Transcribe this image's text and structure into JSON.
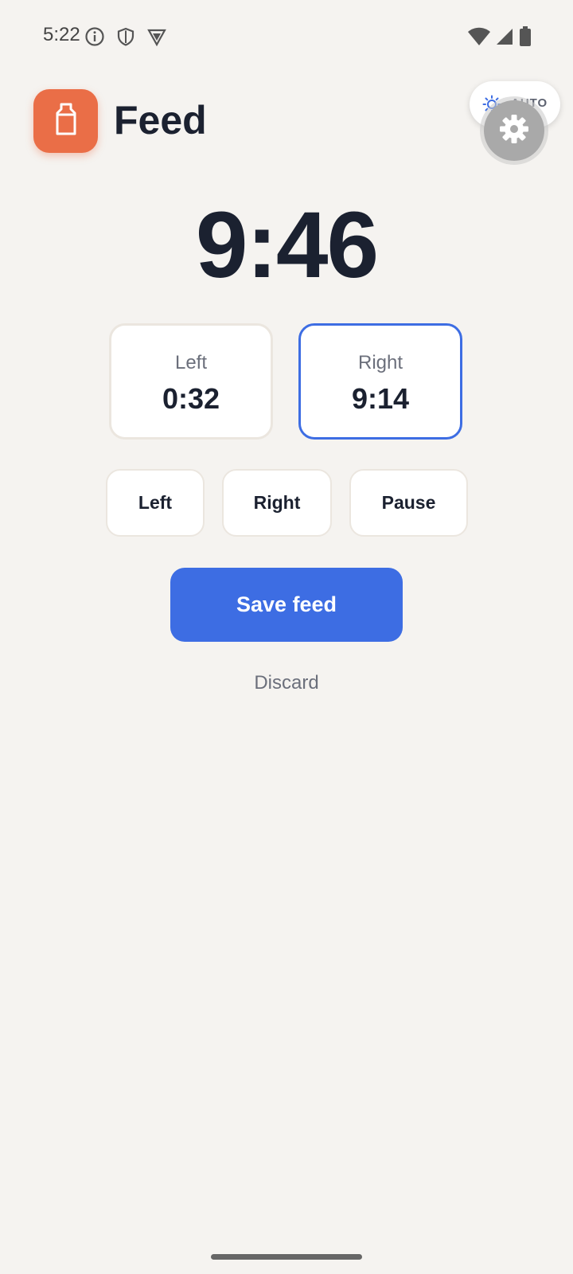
{
  "status_bar": {
    "time": "5:22",
    "icons_left": [
      "info-icon",
      "shield-icon",
      "vpn-icon"
    ],
    "icons_right": [
      "wifi-icon",
      "signal-icon",
      "battery-icon"
    ]
  },
  "header": {
    "logo_icon": "bottle-icon",
    "title": "Feed",
    "theme_toggle_label": "AUTO",
    "theme_icon": "sun-icon",
    "settings_icon": "gear-icon"
  },
  "timer": {
    "total": "9:46"
  },
  "sides": {
    "left": {
      "label": "Left",
      "time": "0:32"
    },
    "right": {
      "label": "Right",
      "time": "9:14",
      "active": true
    }
  },
  "controls": {
    "left_label": "Left",
    "right_label": "Right",
    "pause_label": "Pause"
  },
  "actions": {
    "save_label": "Save feed",
    "discard_label": "Discard"
  },
  "colors": {
    "background": "#f5f3f0",
    "accent": "#3d6de3",
    "brand": "#ea6e47",
    "text_primary": "#1b2130",
    "text_secondary": "#6b6f7b"
  }
}
